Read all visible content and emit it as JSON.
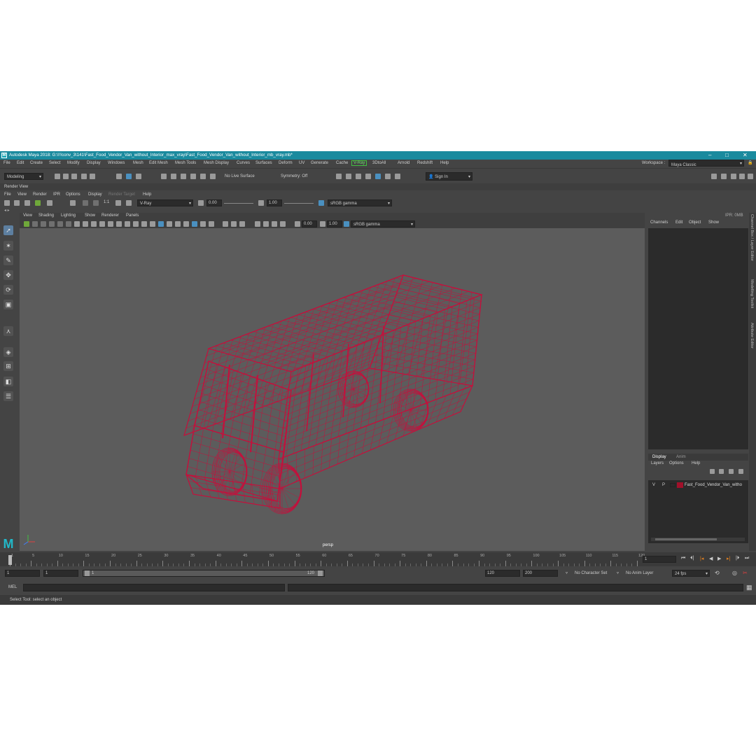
{
  "window": {
    "title": "Autodesk Maya 2018: G:\\!!!conv_3\\141\\Fast_Food_Vendor_Van_without_Interior_max_vray\\Fast_Food_Vendor_Van_without_Interior_mb_vray.mb*",
    "logo": "M"
  },
  "menubar": {
    "items": [
      "File",
      "Edit",
      "Create",
      "Select",
      "Modify",
      "Display",
      "Windows",
      "Mesh",
      "Edit Mesh",
      "Mesh Tools",
      "Mesh Display",
      "Curves",
      "Surfaces",
      "Deform",
      "UV",
      "Generate",
      "Cache",
      "V-Ray",
      "3DtoAll",
      "Arnold",
      "Redshift",
      "Help"
    ],
    "workspace_label": "Workspace :",
    "workspace_value": "Maya Classic"
  },
  "shelf": {
    "mode": "Modeling",
    "live_surface": "No Live Surface",
    "symmetry": "Symmetry: Off",
    "sign_in": "Sign In"
  },
  "render_view": {
    "title": "Render View",
    "menu": [
      "File",
      "View",
      "Render",
      "IPR",
      "Options",
      "Display",
      "Render Target",
      "Help"
    ],
    "ratio": "1:1",
    "renderer": "V-Ray",
    "exposure": "0.00",
    "gamma": "1.00",
    "color_space": "sRGB gamma",
    "ipr_label": "IPR: 0MB"
  },
  "viewport": {
    "menu": [
      "View",
      "Shading",
      "Lighting",
      "Show",
      "Renderer",
      "Panels"
    ],
    "exposure": "0.00",
    "gamma": "1.00",
    "color_space": "sRGB gamma",
    "camera_label": "persp",
    "wire_color": "#c4103c",
    "bg_color": "#5c5c5c"
  },
  "channel_box": {
    "tabs": [
      "Channels",
      "Edit",
      "Object",
      "Show"
    ]
  },
  "layer_editor": {
    "tabs": [
      "Display",
      "Anim"
    ],
    "menu": [
      "Layers",
      "Options",
      "Help"
    ],
    "layer": {
      "v": "V",
      "p": "P",
      "name": "Fast_Food_Vendor_Van_witho",
      "color": "#a0102a"
    }
  },
  "side_tabs": [
    "Channel Box / Layer Editor",
    "Modelling Toolkit",
    "Attribute Editor"
  ],
  "timeline": {
    "ticks": [
      "1",
      "5",
      "10",
      "15",
      "20",
      "25",
      "30",
      "35",
      "40",
      "45",
      "50",
      "55",
      "60",
      "65",
      "70",
      "75",
      "80",
      "85",
      "90",
      "95",
      "100",
      "105",
      "110",
      "115",
      "120"
    ],
    "current_frame": "1"
  },
  "range": {
    "start": "1",
    "playback_start": "1",
    "slider_start": "1",
    "slider_end": "120",
    "playback_end": "120",
    "end": "200",
    "character_set": "No Character Set",
    "anim_layer": "No Anim Layer",
    "fps": "24 fps"
  },
  "command": {
    "lang": "MEL"
  },
  "help_line": "Select Tool: select an object"
}
